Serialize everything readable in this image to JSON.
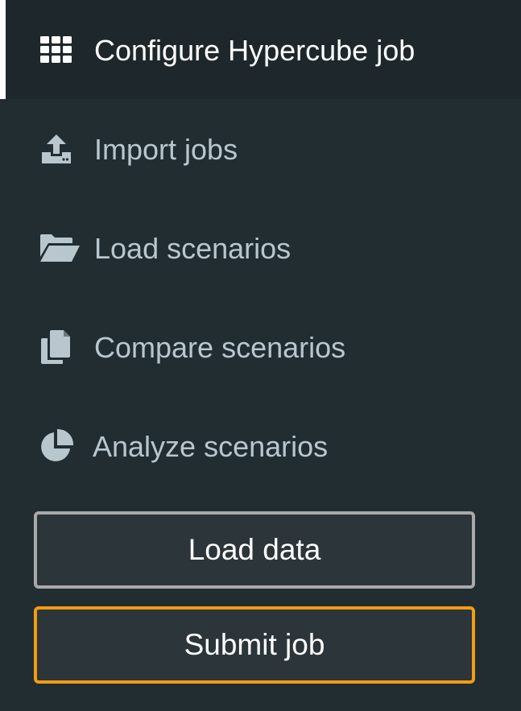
{
  "menu": {
    "items": [
      {
        "label": "Configure Hypercube job",
        "icon": "th-icon",
        "active": true
      },
      {
        "label": "Import jobs",
        "icon": "upload-icon",
        "active": false
      },
      {
        "label": "Load scenarios",
        "icon": "folder-open-icon",
        "active": false
      },
      {
        "label": "Compare scenarios",
        "icon": "copy-icon",
        "active": false
      },
      {
        "label": "Analyze scenarios",
        "icon": "pie-chart-icon",
        "active": false
      }
    ]
  },
  "buttons": {
    "load_data": "Load data",
    "submit_job": "Submit job"
  },
  "colors": {
    "background": "#222d32",
    "active_background": "#1e282c",
    "text": "#b8c7ce",
    "active_text": "#ffffff",
    "submit_border": "#f39c12",
    "load_border": "#a9a9a9"
  }
}
